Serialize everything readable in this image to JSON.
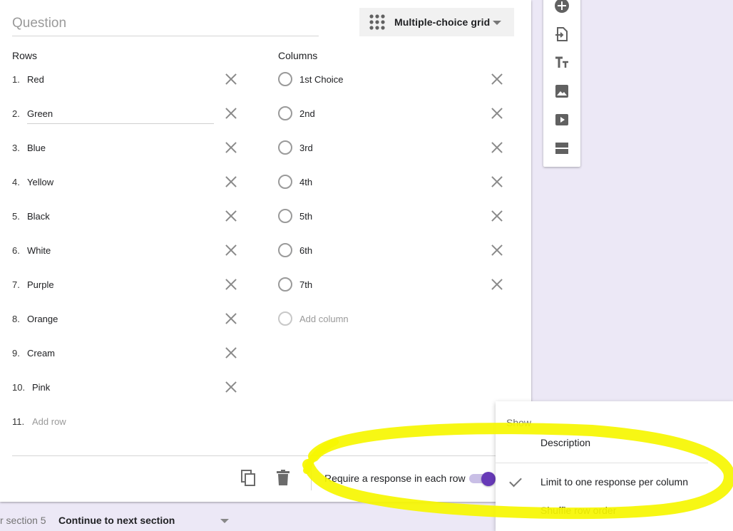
{
  "question": {
    "placeholder": "Question"
  },
  "question_type": {
    "label": "Multiple-choice grid",
    "icon": "grid-dots-icon"
  },
  "rows": {
    "heading": "Rows",
    "items": [
      {
        "num": "1.",
        "label": "Red"
      },
      {
        "num": "2.",
        "label": "Green"
      },
      {
        "num": "3.",
        "label": "Blue"
      },
      {
        "num": "4.",
        "label": "Yellow"
      },
      {
        "num": "5.",
        "label": "Black"
      },
      {
        "num": "6.",
        "label": "White"
      },
      {
        "num": "7.",
        "label": "Purple"
      },
      {
        "num": "8.",
        "label": "Orange"
      },
      {
        "num": "9.",
        "label": "Cream"
      },
      {
        "num": "10.",
        "label": "Pink"
      }
    ],
    "add": {
      "num": "11.",
      "label": "Add row"
    }
  },
  "columns": {
    "heading": "Columns",
    "items": [
      "1st Choice",
      "2nd",
      "3rd",
      "4th",
      "5th",
      "6th",
      "7th"
    ],
    "add": "Add column"
  },
  "footer": {
    "require_label": "Require a response in each row",
    "require_on": true
  },
  "toolbar": {
    "icons": [
      "add-question-icon",
      "import-questions-icon",
      "add-title-icon",
      "add-image-icon",
      "add-video-icon",
      "add-section-icon"
    ]
  },
  "menu": {
    "heading": "Show",
    "items": [
      {
        "label": "Description",
        "checked": false
      },
      {
        "label": "Limit to one response per column",
        "checked": true
      },
      {
        "label": "Shuffle row order",
        "checked": false
      }
    ]
  },
  "section_nav": {
    "after_label": "r section 5",
    "value": "Continue to next section"
  },
  "colors": {
    "accent": "#673ab7",
    "highlight": "#f6f600",
    "background": "#ece8f6"
  }
}
